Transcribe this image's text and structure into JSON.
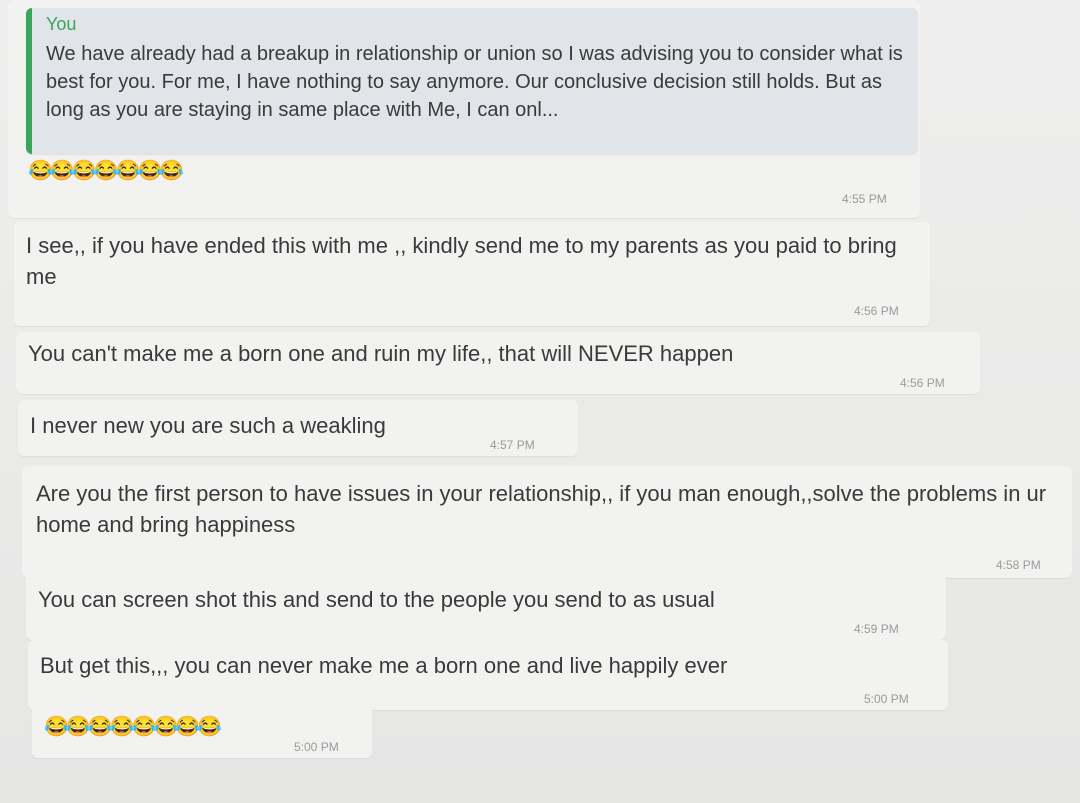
{
  "quoted": {
    "author": "You",
    "text": "We have already had a breakup in relationship or union so I was advising you to consider what is best for you. For me, I have nothing to say anymore. Our conclusive decision still holds. But as long as you are staying in same place with Me, I can onl..."
  },
  "messages": [
    {
      "text": "😂😂😂😂😂😂😂",
      "time": "4:55 PM"
    },
    {
      "text": "I see,, if you have ended this with me ,, kindly send me to my parents as you paid to bring me",
      "time": "4:56 PM"
    },
    {
      "text": "You can't make me a born one and ruin my life,, that will NEVER happen",
      "time": "4:56 PM"
    },
    {
      "text": "I never new you are such a weakling",
      "time": "4:57 PM"
    },
    {
      "text": "Are you the first person to have issues in your  relationship,, if you man enough,,solve the problems in ur home and bring happiness",
      "time": "4:58 PM"
    },
    {
      "text": "You can screen shot this and send to the people you send to as usual",
      "time": "4:59 PM"
    },
    {
      "text": "But get this,,, you can never make me a born one and live happily ever",
      "time": "5:00 PM"
    },
    {
      "text": "😂😂😂😂😂😂😂😂",
      "time": "5:00 PM"
    }
  ]
}
